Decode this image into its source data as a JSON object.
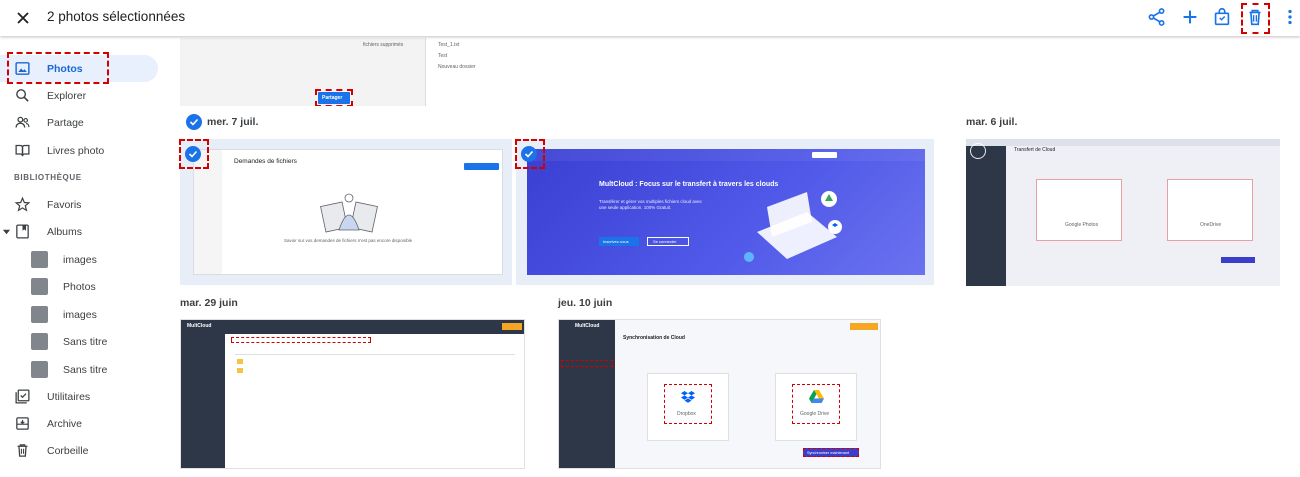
{
  "topbar": {
    "title": "2 photos sélectionnées",
    "actions": [
      "share-icon",
      "add-icon",
      "shopping-bag-icon",
      "delete-icon",
      "more-vert-icon"
    ]
  },
  "sidebar": {
    "items": [
      {
        "label": "Photos",
        "icon": "photo-icon",
        "active": true
      },
      {
        "label": "Explorer",
        "icon": "search-icon"
      },
      {
        "label": "Partage",
        "icon": "people-icon"
      },
      {
        "label": "Livres photo",
        "icon": "book-icon"
      }
    ],
    "library_label": "BIBLIOTHÈQUE",
    "library": [
      {
        "label": "Favoris",
        "icon": "star-icon"
      },
      {
        "label": "Albums",
        "icon": "album-icon"
      }
    ],
    "albums": [
      "images",
      "Photos",
      "images",
      "Sans titre",
      "Sans titre"
    ],
    "bottom": [
      {
        "label": "Utilitaires",
        "icon": "utilities-icon"
      },
      {
        "label": "Archive",
        "icon": "archive-icon"
      },
      {
        "label": "Corbeille",
        "icon": "trash-icon"
      }
    ]
  },
  "dates": {
    "d1": "mer. 7 juil.",
    "d2": "mar. 6 juil.",
    "d3": "mar. 29 juin",
    "d4": "jeu. 10 juin"
  },
  "thumbs": {
    "top_strip": {
      "share_button": "Partager",
      "deleted_files": "fichiers supprimés",
      "rows": [
        "Test_1.txt",
        "Test",
        "Nouveau dossier"
      ]
    },
    "p1": {
      "heading": "Demandes de fichiers",
      "empty": "Savoir sur vos demandes de fichiers n'est pas encore disponible"
    },
    "p2": {
      "headline": "MultCloud : Focus sur le transfert à travers les clouds",
      "sub": "Transférer et gérer vos multiples fichiers cloud avec une seule application. 100% Gratuit.",
      "btn1": "Inscrivez-vous",
      "btn2": "Se connecter"
    },
    "p3": {
      "heading": "Transfert de Cloud",
      "left": "Google Photos",
      "right": "OneDrive"
    },
    "p4": {
      "brand": "MultCloud"
    },
    "p5": {
      "brand": "MultCloud",
      "heading": "Synchronisation de Cloud",
      "left": "Dropbox",
      "right": "Google Drive",
      "button": "Synchroniser maintenant"
    }
  },
  "colors": {
    "accent": "#1a73e8",
    "highlight": "#d40000",
    "multcloud_blue": "#3b3ec9",
    "multcloud_sidebar": "#2d3748"
  }
}
